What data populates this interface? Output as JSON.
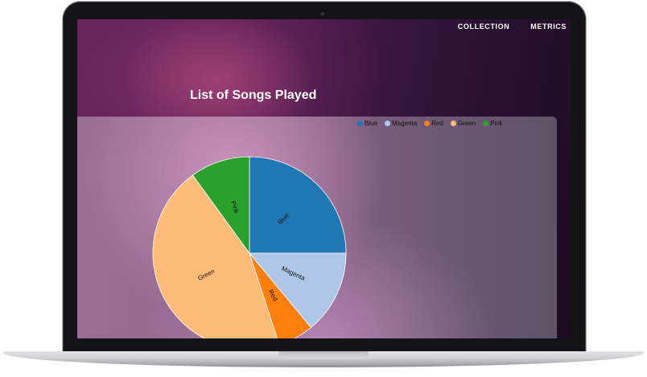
{
  "nav": {
    "collection": "COLLECTION",
    "metrics": "METRICS"
  },
  "heading": "List of Songs Played",
  "chart_data": {
    "type": "pie",
    "title": "List of Songs Played",
    "legend_position": "top-right",
    "slices": [
      {
        "label": "Blue",
        "value": 25,
        "color": "#1f77b4"
      },
      {
        "label": "Magenta",
        "value": 14,
        "color": "#aec7e8"
      },
      {
        "label": "Red",
        "value": 6,
        "color": "#ff7f0e"
      },
      {
        "label": "Green",
        "value": 45,
        "color": "#ffbb78"
      },
      {
        "label": "Pink",
        "value": 10,
        "color": "#2ca02c"
      }
    ]
  }
}
